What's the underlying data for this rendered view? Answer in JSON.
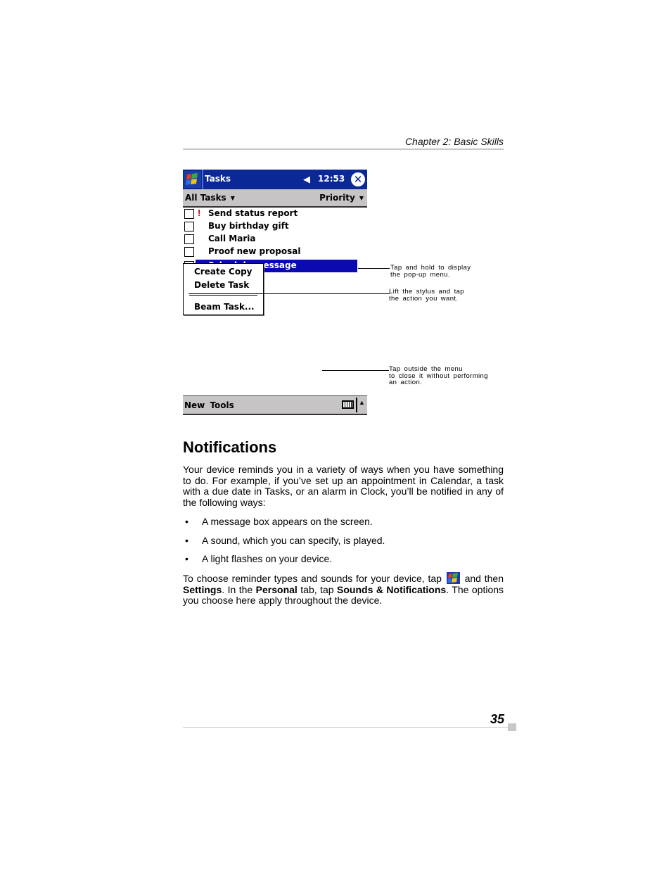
{
  "header": {
    "chapter": "Chapter 2: Basic Skills"
  },
  "pda": {
    "title": "Tasks",
    "time": "12:53",
    "icons": {
      "start": "windows-flag-icon",
      "speaker": "speaker-icon",
      "close": "close-icon"
    },
    "filter": {
      "left": "All Tasks",
      "right": "Priority"
    },
    "tasks": [
      {
        "label": "Send status report",
        "high_priority": true,
        "checked": false
      },
      {
        "label": "Buy birthday gift",
        "high_priority": false,
        "checked": false
      },
      {
        "label": "Call Maria",
        "high_priority": false,
        "checked": false
      },
      {
        "label": "Proof new proposal",
        "high_priority": false,
        "checked": false
      },
      {
        "label": "Schedule message",
        "visible_fragment": "ssage",
        "selected": true,
        "checked": false
      }
    ],
    "popup_menu": [
      "Create Copy",
      "Delete Task",
      "Beam Task..."
    ],
    "menubar": {
      "label": "New Tools",
      "icons": [
        "keyboard-icon",
        "arrow-up-icon"
      ]
    },
    "priority_mark": "!"
  },
  "callouts": [
    {
      "line1": "Tap and hold to display",
      "line2": "the pop-up menu."
    },
    {
      "line1": "Lift the stylus and tap",
      "line2": "the action you want."
    },
    {
      "line1": "Tap outside the menu",
      "line2": "to close it without performing",
      "line3": "an action."
    }
  ],
  "section": {
    "title": "Notifications",
    "intro": "Your device reminds you in a variety of ways when you have something to do. For example, if you’ve set up an appointment in Calendar, a task with a due date in Tasks, or an alarm in Clock, you’ll be notified in any of the following ways:",
    "bullets": [
      "A message box appears on the screen.",
      "A sound, which you can specify, is played.",
      "A light flashes on your device."
    ],
    "closing": {
      "p1": "To choose reminder types and sounds for your device, tap",
      "p2": "and then",
      "settings": "Settings",
      "p3": ". In the",
      "personal": "Personal",
      "p4": "tab, tap",
      "sounds": "Sounds & Notifications",
      "p5": ". The options you choose here apply throughout the device."
    },
    "bullet_char": "•"
  },
  "footer": {
    "page_number": "35"
  }
}
